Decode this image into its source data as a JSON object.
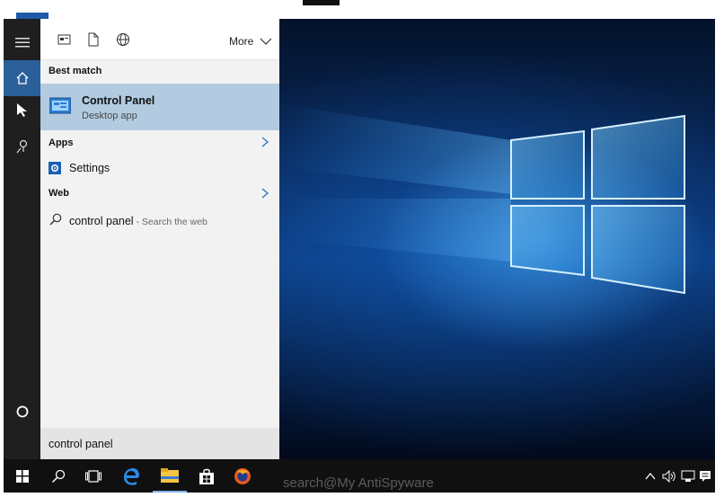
{
  "panel": {
    "more_label": "More",
    "best_match_heading": "Best match",
    "best_match_title": "Control Panel",
    "best_match_subtitle": "Desktop app",
    "apps_heading": "Apps",
    "settings_label": "Settings",
    "web_heading": "Web",
    "web_result_query": "control panel",
    "web_result_suffix": " - Search the web",
    "search_value": "control panel"
  },
  "watermark": "search@My AntiSpyware",
  "icons": {
    "rail": [
      "hamburger-icon",
      "home-icon",
      "notebook-icon",
      "feedback-icon",
      "circle-icon"
    ],
    "panel_top": [
      "apps-filter-icon",
      "documents-filter-icon",
      "web-filter-icon"
    ],
    "taskbar": [
      "windows-start-icon",
      "search-icon",
      "task-view-icon",
      "edge-icon",
      "file-explorer-icon",
      "store-icon",
      "firefox-icon"
    ],
    "tray": [
      "chevron-up-icon",
      "volume-icon",
      "network-icon",
      "action-center-icon"
    ]
  },
  "colors": {
    "accent": "#1e5aa8",
    "selected_row": "#b2cbe0",
    "rail": "#1f1f1f",
    "taskbar": "#101010"
  }
}
